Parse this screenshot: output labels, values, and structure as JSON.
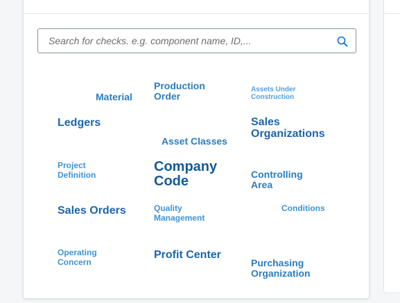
{
  "search": {
    "placeholder": "Search for checks. e.g. component name, ID,...",
    "icon": "search-icon"
  },
  "tag_cloud": {
    "words": [
      {
        "label": "Material"
      },
      {
        "label": "Production\nOrder"
      },
      {
        "label": "Assets Under\nConstruction"
      },
      {
        "label": "Ledgers"
      },
      {
        "label": "Asset Classes"
      },
      {
        "label": "Sales\nOrganizations"
      },
      {
        "label": "Project\nDefinition"
      },
      {
        "label": "Company\nCode"
      },
      {
        "label": "Controlling\nArea"
      },
      {
        "label": "Sales Orders"
      },
      {
        "label": "Quality\nManagement"
      },
      {
        "label": "Conditions"
      },
      {
        "label": "Operating\nConcern"
      },
      {
        "label": "Profit Center"
      },
      {
        "label": "Purchasing\nOrganization"
      }
    ]
  },
  "colors": {
    "link": "#2b7dbc",
    "link_dark": "#15599b",
    "link_light": "#4fa0e0",
    "card_border": "#e2e4e6",
    "background": "#f5f6f7"
  }
}
